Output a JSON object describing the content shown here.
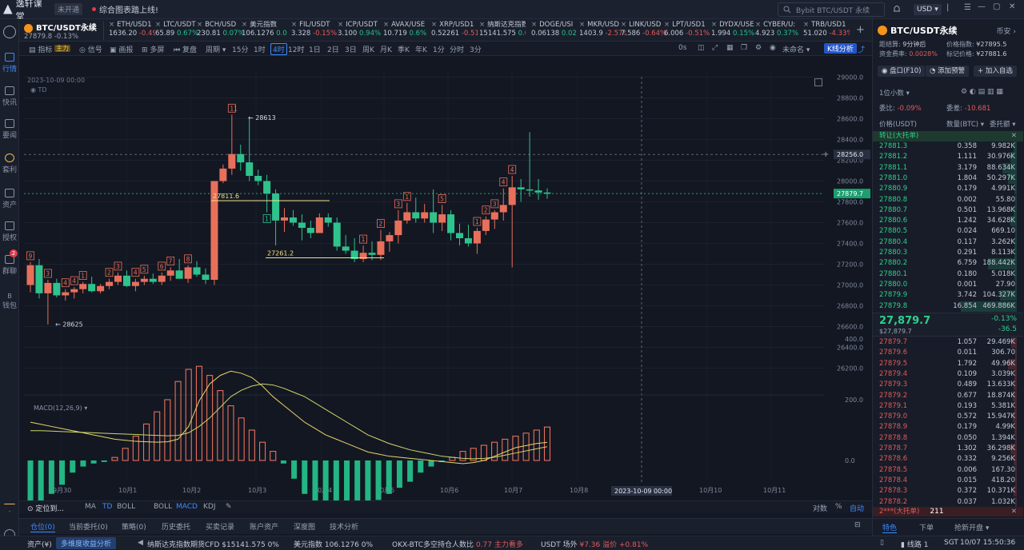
{
  "titlebar": {
    "app_name": "逸轩课堂",
    "badge": "未开通",
    "tab": "综合图表踏上线!",
    "search_placeholder": "Bybit BTC/USDT 永续",
    "currency": "USD"
  },
  "leftnav": [
    {
      "label": "行情",
      "active": true
    },
    {
      "label": "快讯"
    },
    {
      "label": "要闻"
    },
    {
      "label": "套利"
    },
    {
      "label": "资产"
    },
    {
      "label": "授权"
    },
    {
      "label": "群聊",
      "badge": "2"
    },
    {
      "label": "钱包"
    }
  ],
  "tickers": {
    "main": {
      "pair": "BTC/USDT永续",
      "price": "27879.8",
      "change": "-0.13%"
    },
    "list": [
      {
        "pair": "ETH/USD1",
        "price": "1636.20",
        "change": "-0.49"
      },
      {
        "pair": "LTC/USDT",
        "price": "65.89",
        "change": "0.67%"
      },
      {
        "pair": "BCH/USD",
        "price": "230.81",
        "change": "0.07%"
      },
      {
        "pair": "美元指数",
        "price": "106.1276",
        "change": "0.0"
      },
      {
        "pair": "FIL/USDT",
        "price": "3.328",
        "change": "-0.15%"
      },
      {
        "pair": "ICP/USDT",
        "price": "3.100",
        "change": "0.94%"
      },
      {
        "pair": "AVAX/USE",
        "price": "10.719",
        "change": "0.6%"
      },
      {
        "pair": "XRP/USD1",
        "price": "0.52261",
        "change": "-0.51"
      },
      {
        "pair": "纳斯达克指数",
        "price": "15141.575",
        "change": "0.0"
      },
      {
        "pair": "DOGE/USI",
        "price": "0.06138",
        "change": "0.02"
      },
      {
        "pair": "MKR/USD",
        "price": "1403.9",
        "change": "-2.57%"
      },
      {
        "pair": "LINK/USD",
        "price": "7.586",
        "change": "-0.64%"
      },
      {
        "pair": "LPT/USD1",
        "price": "6.006",
        "change": "-0.51%"
      },
      {
        "pair": "DYDX/USE",
        "price": "1.994",
        "change": "0.15%"
      },
      {
        "pair": "CYBER/U:",
        "price": "4.923",
        "change": "0.37%"
      },
      {
        "pair": "TRB/USD1",
        "price": "51.020",
        "change": "-4.33%"
      }
    ]
  },
  "toolbar": {
    "items": [
      "指标",
      "主力",
      "信号",
      "画报",
      "多屏",
      "复盘",
      "周期",
      "15分",
      "1时",
      "4时",
      "12时",
      "1日",
      "2日",
      "3日",
      "周K",
      "月K",
      "季K",
      "年K",
      "1分",
      "分时",
      "3分"
    ],
    "active": "4时",
    "right": [
      "0s",
      "未命名",
      "K线分析"
    ]
  },
  "chart": {
    "symbol_date": "2023-10-09 00:00",
    "td_label": "TD",
    "macd_label": "MACD(12,26,9)",
    "crosshair_date": "2023-10-09 00:00",
    "last_price": "27879.7",
    "cross_price": "28256.0",
    "annotations": {
      "high": "28613",
      "low": "28625",
      "level1": "27811.6",
      "level2": "27261.2"
    },
    "bottom_indicators": [
      "定位到...",
      "MA",
      "TD",
      "BOLL",
      "BOLL",
      "MACD",
      "KDJ"
    ],
    "right_controls": [
      "对数",
      "%",
      "自动"
    ]
  },
  "chart_data": {
    "type": "candlestick",
    "price_axis": [
      "29000.0",
      "28800.0",
      "28600.0",
      "28400.0",
      "28200.0",
      "28000.0",
      "27800.0",
      "27600.0",
      "27400.0",
      "27200.0",
      "27000.0",
      "26800.0",
      "26600.0",
      "26400.0",
      "26200.0"
    ],
    "macd_axis": [
      "400.0",
      "200.0",
      "0.0"
    ],
    "date_axis": [
      "9月30",
      "10月1",
      "10月2",
      "10月3",
      "10月4",
      "10月5",
      "10月6",
      "10月7",
      "10月8",
      "10月10",
      "10月11"
    ],
    "ylim": [
      26050,
      29050
    ],
    "candles": [
      [
        27000,
        27220,
        26930,
        27190,
        "9"
      ],
      [
        27190,
        27250,
        26870,
        26920,
        ""
      ],
      [
        26920,
        27050,
        26620,
        27020,
        "3"
      ],
      [
        27020,
        27060,
        26880,
        26900,
        ""
      ],
      [
        26900,
        26960,
        26850,
        26930,
        "4"
      ],
      [
        26930,
        26980,
        26870,
        26960,
        "4"
      ],
      [
        26960,
        27030,
        26920,
        27010,
        "1"
      ],
      [
        27010,
        27080,
        26930,
        26940,
        ""
      ],
      [
        26940,
        27010,
        26920,
        26990,
        ""
      ],
      [
        26990,
        27060,
        26960,
        27030,
        "2"
      ],
      [
        27030,
        27120,
        27000,
        27090,
        "3"
      ],
      [
        27090,
        27140,
        26980,
        26990,
        ""
      ],
      [
        26990,
        27060,
        26940,
        27030,
        "4"
      ],
      [
        27030,
        27090,
        27000,
        27060,
        "5"
      ],
      [
        27060,
        27110,
        27010,
        27030,
        ""
      ],
      [
        27030,
        27120,
        27000,
        27090,
        "6"
      ],
      [
        27090,
        27170,
        27040,
        27140,
        "7"
      ],
      [
        27140,
        27250,
        27100,
        27060,
        ""
      ],
      [
        27060,
        27190,
        27020,
        27170,
        "8"
      ],
      [
        27170,
        27230,
        27080,
        27100,
        ""
      ],
      [
        27100,
        27160,
        27010,
        27050,
        ""
      ],
      [
        27050,
        27830,
        27000,
        28000,
        ""
      ],
      [
        28000,
        28160,
        27980,
        28120,
        ""
      ],
      [
        28120,
        28640,
        28060,
        28260,
        "11"
      ],
      [
        28260,
        28350,
        28100,
        28180,
        ""
      ],
      [
        28180,
        28613,
        28000,
        28050,
        ""
      ],
      [
        28050,
        28110,
        27960,
        28000,
        ""
      ],
      [
        28000,
        28060,
        27700,
        27880,
        "1"
      ],
      [
        27880,
        27920,
        27380,
        27620,
        ""
      ],
      [
        27620,
        27740,
        27510,
        27650,
        ""
      ],
      [
        27650,
        27720,
        27570,
        27600,
        ""
      ],
      [
        27600,
        27680,
        27430,
        27550,
        ""
      ],
      [
        27550,
        27620,
        27450,
        27500,
        ""
      ],
      [
        27500,
        27690,
        27500,
        27650,
        ""
      ],
      [
        27650,
        27690,
        27560,
        27600,
        ""
      ],
      [
        27600,
        27650,
        27330,
        27370,
        ""
      ],
      [
        27370,
        27480,
        27300,
        27330,
        ""
      ],
      [
        27330,
        27450,
        27220,
        27250,
        ""
      ],
      [
        27250,
        27380,
        27220,
        27310,
        "1"
      ],
      [
        27310,
        27420,
        27240,
        27290,
        ""
      ],
      [
        27290,
        27530,
        27240,
        27420,
        "2"
      ],
      [
        27420,
        27510,
        27320,
        27480,
        ""
      ],
      [
        27480,
        27720,
        27400,
        27620,
        "3"
      ],
      [
        27620,
        27790,
        27590,
        27700,
        "1"
      ],
      [
        27700,
        27840,
        27600,
        27640,
        ""
      ],
      [
        27640,
        27780,
        27600,
        27700,
        ""
      ],
      [
        27700,
        27920,
        27500,
        27600,
        ""
      ],
      [
        27600,
        27770,
        27520,
        27680,
        "5"
      ],
      [
        27680,
        27720,
        27430,
        27500,
        ""
      ],
      [
        27500,
        27590,
        27380,
        27450,
        ""
      ],
      [
        27450,
        27580,
        27370,
        27400,
        ""
      ],
      [
        27400,
        27550,
        27300,
        27520,
        "1"
      ],
      [
        27520,
        27660,
        27480,
        27630,
        "2"
      ],
      [
        27630,
        27720,
        27540,
        27700,
        "3"
      ],
      [
        27700,
        27930,
        27620,
        27770,
        "4"
      ],
      [
        27770,
        28050,
        27170,
        27940,
        "4"
      ],
      [
        27940,
        28020,
        27800,
        27920,
        ""
      ],
      [
        27920,
        28470,
        27850,
        27910,
        ""
      ],
      [
        27910,
        28020,
        27820,
        27890,
        ""
      ],
      [
        27890,
        27930,
        27830,
        27880,
        ""
      ]
    ],
    "macd_hist": [
      -160,
      -150,
      -110,
      -80,
      -40,
      -20,
      -10,
      -5,
      10,
      40,
      80,
      120,
      160,
      200,
      260,
      300,
      310,
      280,
      230,
      180,
      140,
      100,
      60,
      30,
      -10,
      -60,
      -110,
      -150,
      -170,
      -170,
      -160,
      -150,
      -140,
      -130,
      -110,
      -90,
      -70,
      -40,
      -20,
      -5,
      10,
      30,
      40,
      50,
      60,
      70,
      80,
      90,
      100,
      110
    ],
    "macd_dif": [
      180,
      170,
      160,
      150,
      140,
      130,
      120,
      110,
      100,
      95,
      90,
      88,
      86,
      88,
      100,
      160,
      280,
      360,
      400,
      420,
      410,
      390,
      350,
      300,
      260,
      220,
      180,
      150,
      120,
      100,
      80,
      60,
      40,
      30,
      20,
      15,
      10,
      5,
      0,
      -5,
      -10,
      -15,
      -10,
      0,
      20,
      40,
      60,
      70,
      80,
      85
    ],
    "macd_dea": [
      140,
      140,
      138,
      136,
      134,
      132,
      130,
      128,
      126,
      124,
      122,
      120,
      118,
      116,
      118,
      130,
      160,
      200,
      250,
      300,
      330,
      350,
      360,
      355,
      340,
      320,
      300,
      270,
      240,
      210,
      180,
      150,
      120,
      100,
      80,
      65,
      50,
      40,
      30,
      20,
      15,
      10,
      8,
      10,
      15,
      25,
      35,
      45,
      55,
      65
    ]
  },
  "bottomtabs": [
    "仓位(0)",
    "当前委托(0)",
    "策略(0)",
    "历史委托",
    "买卖记录",
    "账户资产",
    "深度图",
    "技术分析"
  ],
  "posbar": {
    "left": "资产(¥)",
    "link": "多维度收益分析"
  },
  "statusbar": {
    "items": [
      {
        "label": "纳斯达克指数期货CFD",
        "price": "$15141.575",
        "change": "0%"
      },
      {
        "label": "美元指数",
        "price": "106.1276",
        "change": "0%"
      },
      {
        "label": "OKX-BTC多空持仓人数比",
        "price": "0.77",
        "change": "主力看多"
      },
      {
        "label": "USDT 场外",
        "price": "¥7.36",
        "change": "溢价 +0.81%"
      }
    ],
    "right": [
      "线路 1",
      "SGT",
      "10/07 15:50:36"
    ]
  },
  "rightpanel": {
    "pair": "BTC/USDT永续",
    "pair_type": "币安",
    "funding_label": "距结算",
    "funding_value": "9分钟后",
    "fund_rate_label": "资金费率",
    "fund_rate": "0.0028%",
    "index_label": "价格指数",
    "index_value": "¥27895.5",
    "mark_label": "标记价格",
    "mark_value": "¥27881.6",
    "buttons": [
      "盘口(F10)",
      "添加预警",
      "加入自选"
    ],
    "precision": "1位小数",
    "ratio_label": "委比",
    "ratio_value": "-0.09%",
    "diff_label": "委差",
    "diff_value": "-10.681",
    "headers": [
      "价格(USDT)",
      "数量(BTC)",
      "委托额"
    ],
    "sell_title": "转让(大托单)",
    "buy_title": "2***(大托单)",
    "asks": [
      [
        "27881.3",
        "0.358",
        "9.982K"
      ],
      [
        "27881.2",
        "1.111",
        "30.976K"
      ],
      [
        "27881.1",
        "3.179",
        "88.634K"
      ],
      [
        "27881.0",
        "1.804",
        "50.297K"
      ],
      [
        "27880.9",
        "0.179",
        "4.991K"
      ],
      [
        "27880.8",
        "0.002",
        "55.80"
      ],
      [
        "27880.7",
        "0.501",
        "13.968K"
      ],
      [
        "27880.6",
        "1.242",
        "34.628K"
      ],
      [
        "27880.5",
        "0.024",
        "669.10"
      ],
      [
        "27880.4",
        "0.117",
        "3.262K"
      ],
      [
        "27880.3",
        "0.291",
        "8.113K"
      ],
      [
        "27880.2",
        "6.759",
        "188.442K"
      ],
      [
        "27880.1",
        "0.180",
        "5.018K"
      ],
      [
        "27880.0",
        "0.001",
        "27.90"
      ],
      [
        "27879.9",
        "3.742",
        "104.327K"
      ],
      [
        "27879.8",
        "16.854",
        "469.886K"
      ]
    ],
    "last": "27,879.7",
    "last_sub": "$27,879.7",
    "last_change": "-0.13%",
    "last_delta": "-36.5",
    "bids": [
      [
        "27879.7",
        "1.057",
        "29.469K"
      ],
      [
        "27879.6",
        "0.011",
        "306.70"
      ],
      [
        "27879.5",
        "1.792",
        "49.96K"
      ],
      [
        "27879.4",
        "0.109",
        "3.039K"
      ],
      [
        "27879.3",
        "0.489",
        "13.633K"
      ],
      [
        "27879.2",
        "0.677",
        "18.874K"
      ],
      [
        "27879.1",
        "0.193",
        "5.381K"
      ],
      [
        "27879.0",
        "0.572",
        "15.947K"
      ],
      [
        "27878.9",
        "0.179",
        "4.99K"
      ],
      [
        "27878.8",
        "0.050",
        "1.394K"
      ],
      [
        "27878.7",
        "1.302",
        "36.298K"
      ],
      [
        "27878.6",
        "0.332",
        "9.256K"
      ],
      [
        "27878.5",
        "0.006",
        "167.30"
      ],
      [
        "27878.4",
        "0.015",
        "418.20"
      ],
      [
        "27878.3",
        "0.372",
        "10.371K"
      ],
      [
        "27878.2",
        "0.037",
        "1.032K"
      ]
    ],
    "count": "211",
    "tabs": [
      "特色",
      "下单",
      "抢新开盘"
    ]
  }
}
